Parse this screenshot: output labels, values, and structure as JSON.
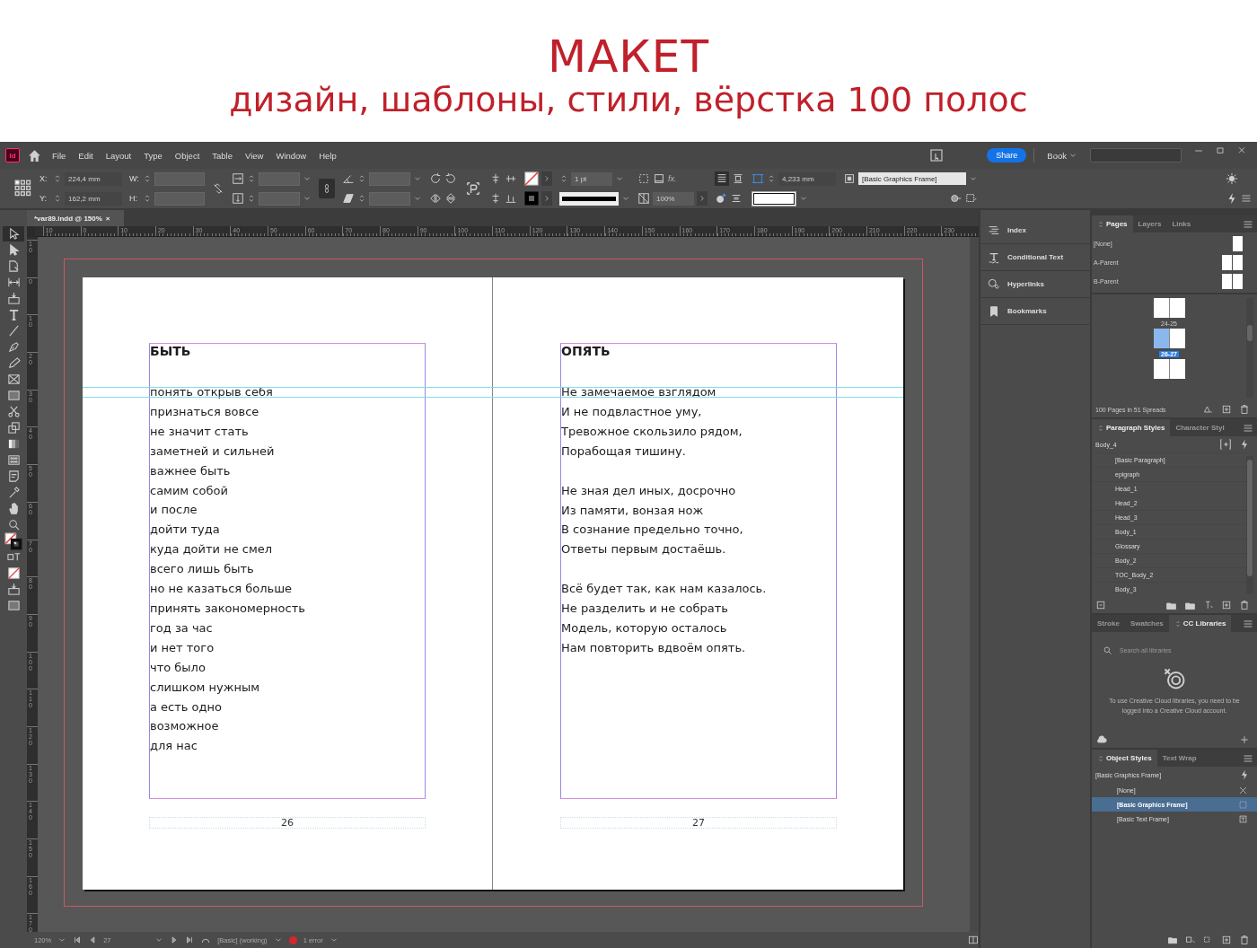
{
  "banner": {
    "title": "МАКЕТ",
    "subtitle": "дизайн, шаблоны, стили, вёрстка 100 полос"
  },
  "app": {
    "logo": "Id",
    "menu": [
      "File",
      "Edit",
      "Layout",
      "Type",
      "Object",
      "Table",
      "View",
      "Window",
      "Help"
    ],
    "share": "Share",
    "workspace": "Book"
  },
  "control_bar": {
    "x_label": "X:",
    "x_value": "224,4 mm",
    "y_label": "Y:",
    "y_value": "162,2 mm",
    "w_label": "W:",
    "h_label": "H:",
    "stroke_weight": "1 pt",
    "effects": "fx.",
    "scale": "100%",
    "spacing": "4,233 mm",
    "object_style": "[Basic Graphics Frame]"
  },
  "document_tab": {
    "title": "*var89.indd @ 150%",
    "close": "×"
  },
  "tools": [
    {
      "kind": "selection",
      "selected": true
    },
    {
      "kind": "direct",
      "selected": false
    },
    {
      "kind": "page",
      "selected": false
    },
    {
      "kind": "gap",
      "selected": false
    },
    {
      "kind": "collector",
      "selected": false
    },
    {
      "kind": "type",
      "selected": false
    },
    {
      "kind": "line",
      "selected": false
    },
    {
      "kind": "pen",
      "selected": false
    },
    {
      "kind": "pencil",
      "selected": false
    },
    {
      "kind": "frame",
      "selected": false
    },
    {
      "kind": "rect",
      "selected": false
    },
    {
      "kind": "scissors",
      "selected": false
    },
    {
      "kind": "transform",
      "selected": false
    },
    {
      "kind": "gradient",
      "selected": false
    },
    {
      "kind": "feather",
      "selected": false
    },
    {
      "kind": "note",
      "selected": false
    },
    {
      "kind": "eyedropper",
      "selected": false
    },
    {
      "kind": "hand",
      "selected": false
    },
    {
      "kind": "zoom",
      "selected": false
    },
    {
      "kind": "fillstroke",
      "selected": false
    },
    {
      "kind": "formatting",
      "selected": false
    },
    {
      "kind": "noneswatch",
      "selected": false
    },
    {
      "kind": "collector",
      "selected": false
    },
    {
      "kind": "screenmode",
      "selected": false
    }
  ],
  "rulers": {
    "horizontal": [
      "10",
      "0",
      "10",
      "20",
      "30",
      "40",
      "50",
      "60",
      "70",
      "80",
      "90",
      "100",
      "110",
      "120",
      "130",
      "140",
      "150",
      "160",
      "170",
      "180",
      "190",
      "200",
      "210",
      "220",
      "230"
    ],
    "vertical": [
      "10",
      "0",
      "10",
      "20",
      "30",
      "40",
      "50",
      "60",
      "70",
      "80",
      "90",
      "100",
      "110",
      "120",
      "130",
      "140",
      "150",
      "160",
      "170"
    ]
  },
  "spread": {
    "pages": [
      {
        "heading": "БЫТЬ",
        "stanzas": [
          [
            "понять открыв себя",
            "признаться вовсе",
            "не значит стать",
            "заметней и сильней",
            "важнее быть",
            "самим собой",
            "и после",
            "дойти туда",
            "куда дойти не смел",
            "всего лишь быть",
            "но не казаться больше",
            "принять закономерность",
            "год за час",
            "и нет того",
            "что было",
            "слишком нужным",
            "а есть одно",
            "возможное",
            "для нас"
          ]
        ],
        "page_number": "26"
      },
      {
        "heading": "ОПЯТЬ",
        "stanzas": [
          [
            "Не замечаемое взглядом",
            "И не подвластное уму,",
            "Тревожное скользило рядом,",
            "Порабощая тишину."
          ],
          [
            "Не зная дел иных, досрочно",
            "Из памяти, вонзая нож",
            "В сознание предельно точно,",
            "Ответы первым достаёшь."
          ],
          [
            "Всё будет так, как нам казалось.",
            "Не разделить и не собрать",
            "Модель, которую осталось",
            "Нам повторить вдвоём опять."
          ]
        ],
        "page_number": "27"
      }
    ]
  },
  "side_panels": [
    {
      "kind": "index",
      "label": "Index"
    },
    {
      "kind": "conditional",
      "label": "Conditional Text"
    },
    {
      "kind": "hyperlinks",
      "label": "Hyperlinks"
    },
    {
      "kind": "bookmarks",
      "label": "Bookmarks"
    }
  ],
  "pages_panel": {
    "tabs": [
      {
        "label": "Pages",
        "selected": true
      },
      {
        "label": "Layers",
        "selected": false
      },
      {
        "label": "Links",
        "selected": false
      }
    ],
    "parents": [
      {
        "name": "[None]",
        "kind": "single"
      },
      {
        "name": "A-Parent",
        "kind": "spread"
      },
      {
        "name": "B-Parent",
        "kind": "spread"
      }
    ],
    "spreads": [
      {
        "label": "24-25",
        "selected": false
      },
      {
        "label": "26-27",
        "selected": true
      },
      {
        "selected": false
      }
    ],
    "summary": "100 Pages in 51 Spreads"
  },
  "paragraph_styles": {
    "tabs": [
      {
        "label": "Paragraph Styles",
        "selected": true
      },
      {
        "label": "Character Styl",
        "selected": false
      }
    ],
    "current": "Body_4",
    "styles": [
      "[Basic Paragraph]",
      "epigraph",
      "Head_1",
      "Head_2",
      "Head_3",
      "Body_1",
      "Glossary",
      "Body_2",
      "TOC_Body_2",
      "Body_3"
    ]
  },
  "cc_libraries": {
    "tabs": [
      {
        "label": "Stroke",
        "selected": false
      },
      {
        "label": "Swatches",
        "selected": false
      },
      {
        "label": "CC Libraries",
        "selected": true
      }
    ],
    "search_placeholder": "Search all libraries",
    "message": "To use Creative Cloud libraries, you need to be logged into a Creative Cloud account."
  },
  "object_styles": {
    "tabs": [
      {
        "label": "Object Styles",
        "selected": true
      },
      {
        "label": "Text Wrap",
        "selected": false
      }
    ],
    "current": "[Basic Graphics Frame]",
    "styles": [
      {
        "name": "[None]",
        "kind": "none",
        "selected": false
      },
      {
        "name": "[Basic Graphics Frame]",
        "kind": "graphics",
        "selected": true
      },
      {
        "name": "[Basic Text Frame]",
        "kind": "text",
        "selected": false
      }
    ]
  },
  "status_bar": {
    "zoom": "120%",
    "page": "27",
    "preflight_profile": "[Basic] (working)",
    "errors": "1 error"
  }
}
